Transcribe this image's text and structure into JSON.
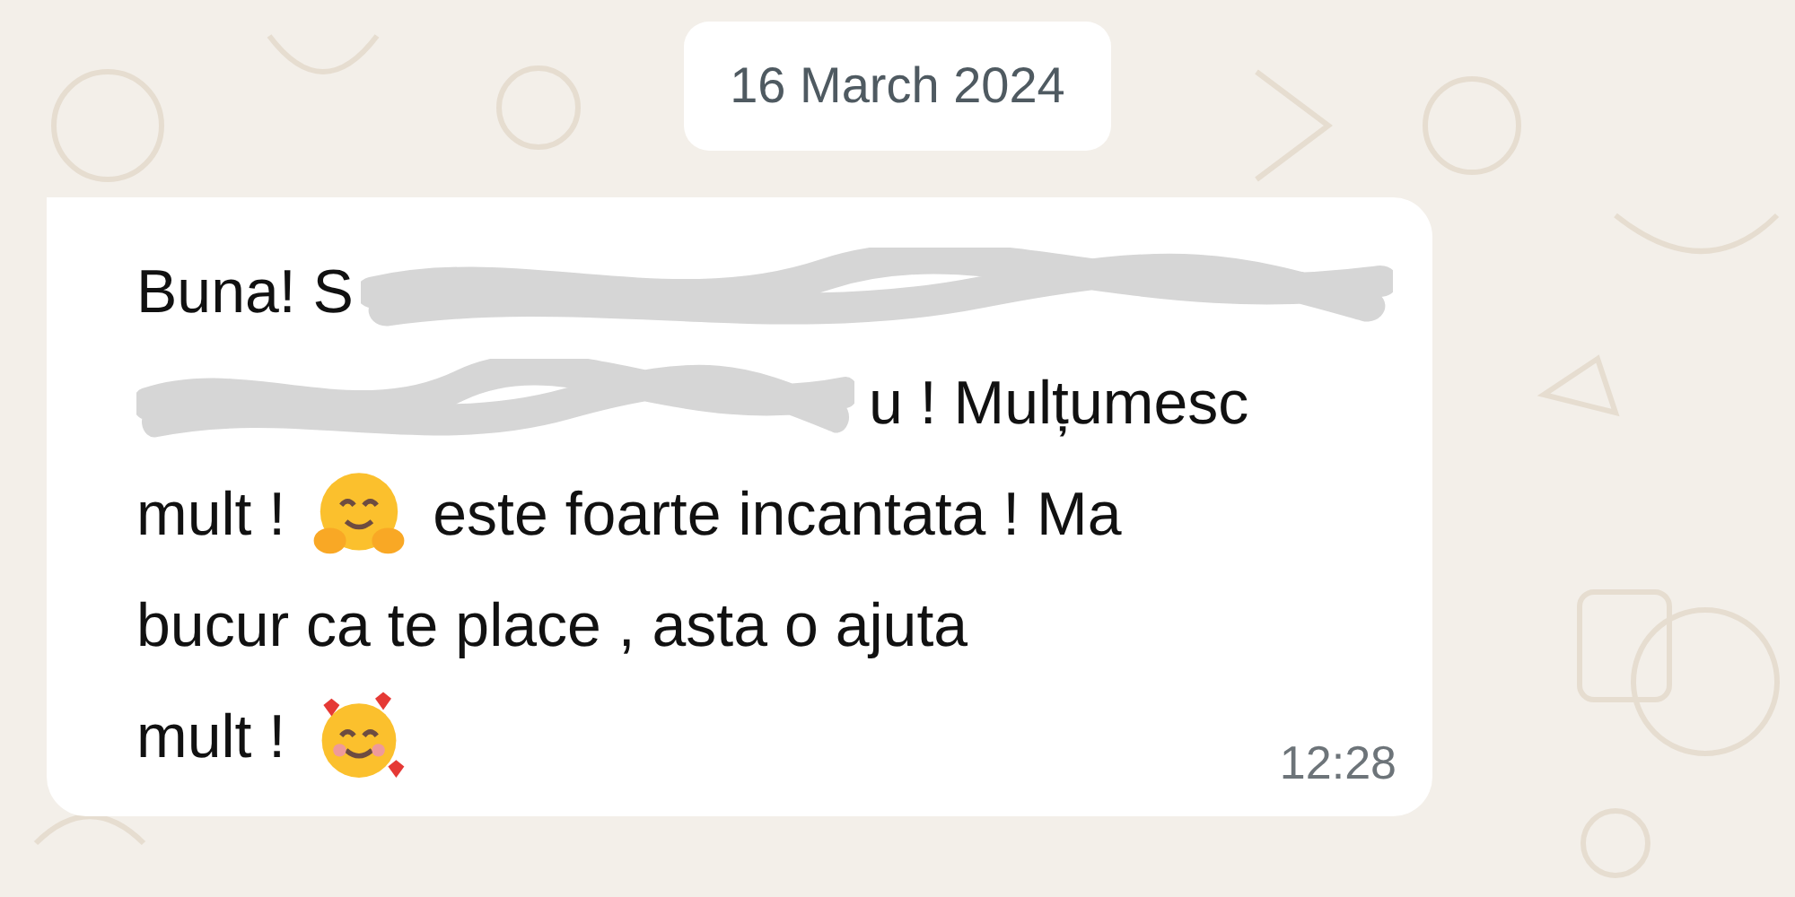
{
  "date_chip": "16 March 2024",
  "message": {
    "lines": [
      [
        {
          "kind": "text",
          "text": "Buna! S"
        },
        {
          "kind": "redacted"
        }
      ],
      [
        {
          "kind": "redacted"
        },
        {
          "kind": "text",
          "text": "u ! Mulțumesc"
        }
      ],
      [
        {
          "kind": "text",
          "text": "mult !"
        },
        {
          "kind": "hug"
        },
        {
          "kind": "text",
          "text": "este foarte incantata ! Ma"
        }
      ],
      [
        {
          "kind": "text",
          "text": "bucur ca te place , asta o ajuta"
        }
      ],
      [
        {
          "kind": "text",
          "text": "mult !"
        },
        {
          "kind": "hearts"
        }
      ]
    ],
    "time": "12:28"
  }
}
